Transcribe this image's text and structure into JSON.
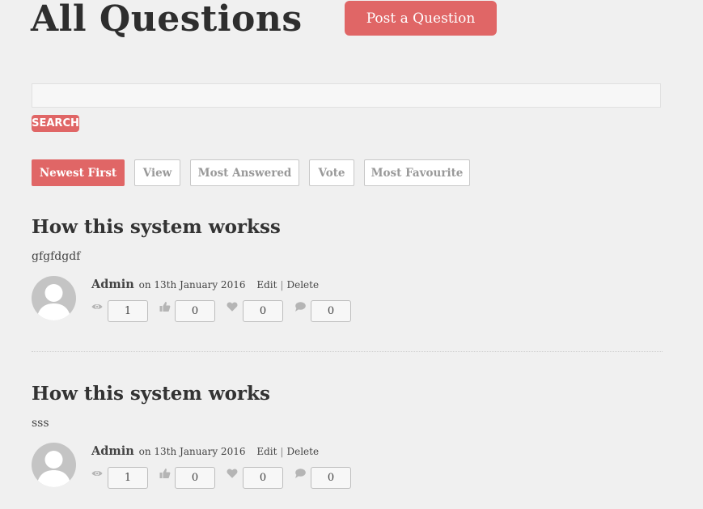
{
  "header": {
    "title": "All Questions",
    "post_button_label": "Post a Question"
  },
  "search": {
    "value": "",
    "placeholder": "",
    "button_label": "SEARCH"
  },
  "sort_tabs": [
    {
      "label": "Newest First",
      "active": true
    },
    {
      "label": "View",
      "active": false
    },
    {
      "label": "Most Answered",
      "active": false
    },
    {
      "label": "Vote",
      "active": false
    },
    {
      "label": "Most Favourite",
      "active": false
    }
  ],
  "questions": [
    {
      "title": "How this system workss",
      "excerpt": "gfgfdgdf",
      "author": "Admin",
      "date": "on 13th January 2016",
      "edit_label": "Edit",
      "separator": "|",
      "delete_label": "Delete",
      "stats": {
        "views": "1",
        "votes": "0",
        "favourites": "0",
        "comments": "0"
      }
    },
    {
      "title": "How this system works",
      "excerpt": "sss",
      "author": "Admin",
      "date": "on 13th January 2016",
      "edit_label": "Edit",
      "separator": "|",
      "delete_label": "Delete",
      "stats": {
        "views": "1",
        "votes": "0",
        "favourites": "0",
        "comments": "0"
      }
    }
  ],
  "icons": {
    "views": "eye-icon",
    "votes": "thumbs-up-icon",
    "favourites": "heart-icon",
    "comments": "comment-icon"
  },
  "colors": {
    "accent": "#e06666",
    "background": "#f0f0f0",
    "icon": "#b5b5b5",
    "avatar": "#c4c4c4"
  }
}
